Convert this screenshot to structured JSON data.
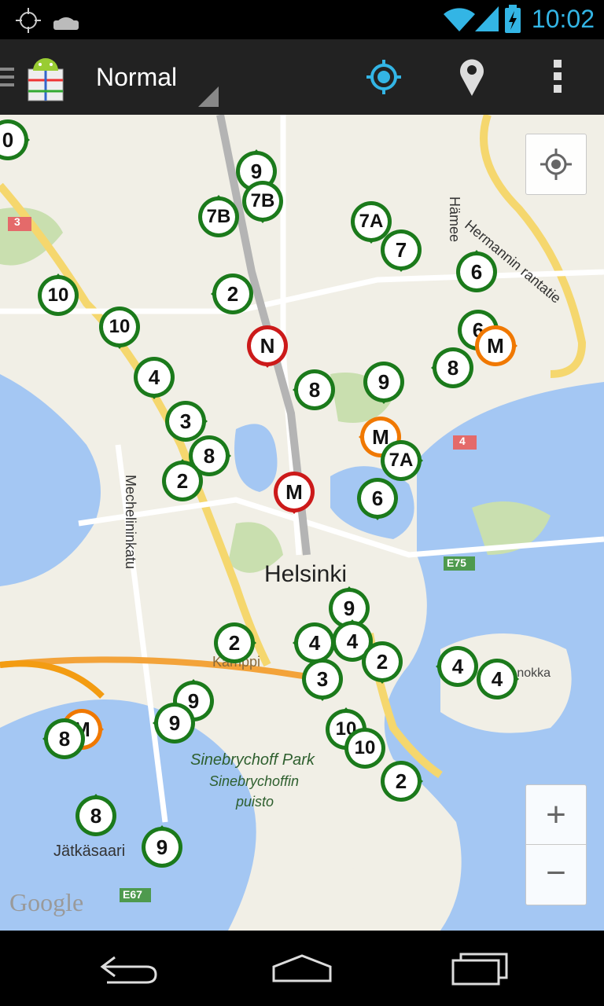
{
  "status_bar": {
    "time": "10:02"
  },
  "action_bar": {
    "title": "Normal"
  },
  "map": {
    "city_label": "Helsinki",
    "labels": {
      "hermannin": "Hermannin rantatie",
      "hameen": "Hämee",
      "mechelininkatu": "Mechelininkatu",
      "kamppi": "Kamppi",
      "sinebrychoff_park": "Sinebrychoff Park",
      "sinebrychoffin": "Sinebrychoffin",
      "puisto": "puisto",
      "jatkasaari": "Jätkäsaari",
      "katajanokka": "Katajanokka",
      "google": "Google",
      "route_3": "3",
      "route_4": "4",
      "route_e75": "E75",
      "route_e67": "E67"
    },
    "markers": [
      {
        "label": "0",
        "color": "green"
      },
      {
        "label": "9",
        "color": "green"
      },
      {
        "label": "7B",
        "color": "green"
      },
      {
        "label": "7B",
        "color": "green"
      },
      {
        "label": "7A",
        "color": "green"
      },
      {
        "label": "7",
        "color": "green"
      },
      {
        "label": "6",
        "color": "green"
      },
      {
        "label": "10",
        "color": "green"
      },
      {
        "label": "2",
        "color": "green"
      },
      {
        "label": "10",
        "color": "green"
      },
      {
        "label": "N",
        "color": "red"
      },
      {
        "label": "6",
        "color": "green"
      },
      {
        "label": "M",
        "color": "orange"
      },
      {
        "label": "4",
        "color": "green"
      },
      {
        "label": "8",
        "color": "green"
      },
      {
        "label": "9",
        "color": "green"
      },
      {
        "label": "8",
        "color": "green"
      },
      {
        "label": "3",
        "color": "green"
      },
      {
        "label": "8",
        "color": "green"
      },
      {
        "label": "M",
        "color": "orange"
      },
      {
        "label": "7A",
        "color": "green"
      },
      {
        "label": "2",
        "color": "green"
      },
      {
        "label": "M",
        "color": "red"
      },
      {
        "label": "6",
        "color": "green"
      },
      {
        "label": "9",
        "color": "green"
      },
      {
        "label": "2",
        "color": "green"
      },
      {
        "label": "4",
        "color": "green"
      },
      {
        "label": "4",
        "color": "green"
      },
      {
        "label": "2",
        "color": "green"
      },
      {
        "label": "3",
        "color": "green"
      },
      {
        "label": "4",
        "color": "green"
      },
      {
        "label": "4",
        "color": "green"
      },
      {
        "label": "9",
        "color": "green"
      },
      {
        "label": "M",
        "color": "orange"
      },
      {
        "label": "9",
        "color": "green"
      },
      {
        "label": "8",
        "color": "green"
      },
      {
        "label": "10",
        "color": "green"
      },
      {
        "label": "10",
        "color": "green"
      },
      {
        "label": "2",
        "color": "green"
      },
      {
        "label": "8",
        "color": "green"
      },
      {
        "label": "9",
        "color": "green"
      }
    ]
  },
  "controls": {
    "zoom_in": "+",
    "zoom_out": "−"
  },
  "colors": {
    "green": "#1b7a1b",
    "red": "#cc1a1a",
    "orange": "#f07800",
    "accent": "#33b5e5"
  }
}
